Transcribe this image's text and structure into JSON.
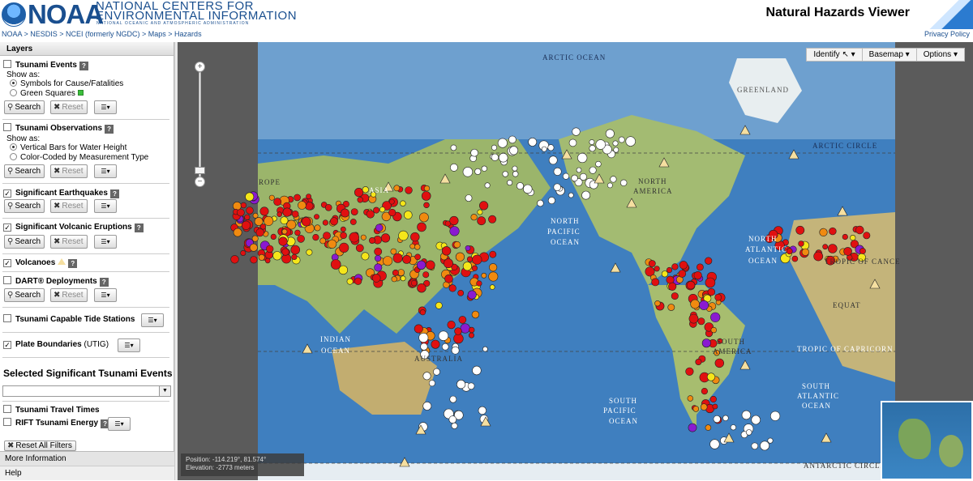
{
  "header": {
    "logo_word": "NOAA",
    "logo_line1": "NATIONAL CENTERS FOR",
    "logo_line2": "ENVIRONMENTAL INFORMATION",
    "logo_line3": "NATIONAL OCEANIC AND ATMOSPHERIC ADMINISTRATION",
    "app_title": "Natural Hazards Viewer"
  },
  "breadcrumb": "NOAA > NESDIS > NCEI (formerly NGDC) > Maps > Hazards",
  "privacy_link": "Privacy Policy",
  "sidebar": {
    "title": "Layers",
    "tsunami_events": {
      "label": "Tsunami Events",
      "checked": false,
      "show_as": "Show as:",
      "opt1": "Symbols for Cause/Fatalities",
      "opt2": "Green Squares"
    },
    "tsunami_obs": {
      "label": "Tsunami Observations",
      "checked": false,
      "show_as": "Show as:",
      "opt1": "Vertical Bars for Water Height",
      "opt2": "Color-Coded by Measurement Type"
    },
    "sig_eq": {
      "label": "Significant Earthquakes",
      "checked": true
    },
    "sig_volc": {
      "label": "Significant Volcanic Eruptions",
      "checked": true
    },
    "volcanoes": {
      "label": "Volcanoes",
      "checked": true
    },
    "dart": {
      "label": "DART® Deployments",
      "checked": false
    },
    "tide": {
      "label": "Tsunami Capable Tide Stations",
      "checked": false
    },
    "plates": {
      "label": "Plate Boundaries",
      "suffix": "(UTIG)",
      "checked": true
    },
    "selected_title": "Selected Significant Tsunami Events",
    "travel_times": {
      "label": "Tsunami Travel Times",
      "checked": false
    },
    "rift": {
      "label": "RIFT Tsunami Energy",
      "checked": false
    },
    "search_label": "Search",
    "reset_label": "Reset",
    "reset_all_label": "Reset All Filters",
    "more_info": "More Information",
    "help": "Help"
  },
  "map": {
    "toolbar": {
      "identify": "Identify",
      "basemap": "Basemap",
      "options": "Options"
    },
    "labels": {
      "arctic_ocean": "ARCTIC OCEAN",
      "greenland": "GREENLAND",
      "arctic_circle": "ARCTIC CIRCLE",
      "asia": "ASIA",
      "europe": "ROPE",
      "north_america_1": "NORTH",
      "north_america_2": "AMERICA",
      "north_pacific_1": "NORTH",
      "north_pacific_2": "PACIFIC",
      "north_pacific_3": "OCEAN",
      "north_atlantic_1": "NORTH",
      "north_atlantic_2": "ATLANTIC",
      "north_atlantic_3": "OCEAN",
      "tropic_cancer": "TROPIC OF CANCE",
      "equator": "EQUAT",
      "indian_1": "INDIAN",
      "indian_2": "OCEAN",
      "australia": "AUSTRALIA",
      "south_america_1": "SOUTH",
      "south_america_2": "AMERICA",
      "tropic_capricorn": "TROPIC OF CAPRICORN",
      "south_atlantic_1": "SOUTH",
      "south_atlantic_2": "ATLANTIC",
      "south_atlantic_3": "OCEAN",
      "south_pacific_1": "SOUTH",
      "south_pacific_2": "PACIFIC",
      "south_pacific_3": "OCEAN",
      "antarctic_circle": "ANTARCTIC CIRCLE"
    },
    "position_text": "Position: -114.219°, 81.574°",
    "elevation_text": "Elevation: -2773 meters"
  },
  "colors": {
    "ocean": "#3f7fbf",
    "land": "#9bb56b",
    "eq_red": "#e01010",
    "eq_orange": "#f08a10",
    "eq_yellow": "#f5e61a",
    "eq_purple": "#8a1ad0",
    "volcano": "#f5dfa0"
  }
}
